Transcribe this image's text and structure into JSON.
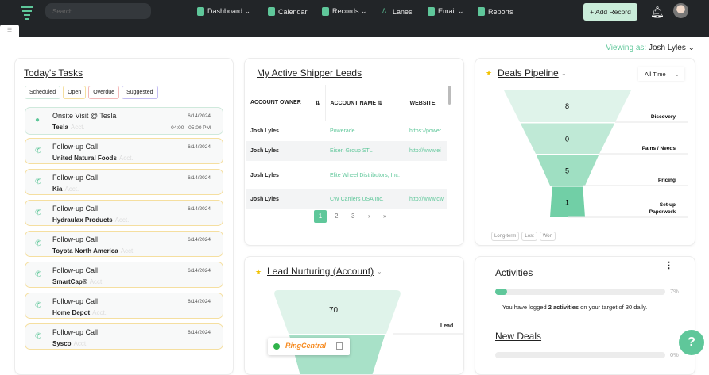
{
  "topbar": {
    "search_placeholder": "Search",
    "nav": [
      {
        "label": "Dashboard ⌄"
      },
      {
        "label": "Calendar"
      },
      {
        "label": "Records ⌄"
      },
      {
        "label": "Lanes"
      },
      {
        "label": "Email ⌄"
      },
      {
        "label": "Reports"
      }
    ],
    "add_record": "+ Add Record"
  },
  "viewing": {
    "label": "Viewing as:",
    "user": "Josh Lyles ⌄"
  },
  "tasks": {
    "title": "Today's Tasks",
    "filters": [
      "Scheduled",
      "Open",
      "Overdue",
      "Suggested"
    ],
    "items": [
      {
        "title": "Onsite Visit @ Tesla",
        "account": "Tesla",
        "date": "6/14/2024",
        "time": "04:00 - 05:00 PM",
        "icon": "location-pin-icon"
      },
      {
        "title": "Follow-up Call",
        "account": "United Natural Foods",
        "date": "6/14/2024",
        "icon": "phone-outgoing-icon"
      },
      {
        "title": "Follow-up Call",
        "account": "Kia",
        "date": "6/14/2024",
        "icon": "phone-outgoing-icon"
      },
      {
        "title": "Follow-up Call",
        "account": "Hydraulax Products",
        "date": "6/14/2024",
        "icon": "phone-outgoing-icon"
      },
      {
        "title": "Follow-up Call",
        "account": "Toyota North America",
        "date": "6/14/2024",
        "icon": "phone-outgoing-icon"
      },
      {
        "title": "Follow-up Call",
        "account": "SmartCap®",
        "date": "6/14/2024",
        "icon": "phone-outgoing-icon"
      },
      {
        "title": "Follow-up Call",
        "account": "Home Depot",
        "date": "6/14/2024",
        "icon": "phone-outgoing-icon"
      },
      {
        "title": "Follow-up Call",
        "account": "Sysco",
        "date": "6/14/2024",
        "icon": "phone-outgoing-icon"
      }
    ],
    "acct_tag": "Acct."
  },
  "leads": {
    "title": "My Active Shipper Leads",
    "columns": [
      "ACCOUNT OWNER",
      "ACCOUNT NAME",
      "WEBSITE"
    ],
    "rows": [
      [
        "Josh Lyles",
        "Powerade",
        "https://power"
      ],
      [
        "Josh Lyles",
        "Eisen Group STL",
        "http://www.ei"
      ],
      [
        "Josh Lyles",
        "Elite Wheel Distributors, Inc.",
        ""
      ],
      [
        "Josh Lyles",
        "CW Carriers USA Inc.",
        "http://www.cw"
      ]
    ],
    "pages": [
      "1",
      "2",
      "3",
      "›",
      "»"
    ]
  },
  "pipeline": {
    "title": "Deals Pipeline",
    "range": "All Time",
    "stages": [
      {
        "name": "Discovery",
        "value": 8
      },
      {
        "name": "Pains / Needs",
        "value": 0
      },
      {
        "name": "Pricing",
        "value": 5
      },
      {
        "name": "Set-up Paperwork",
        "value": 1
      }
    ],
    "tags": [
      "Long-term",
      "Lost",
      "Won"
    ]
  },
  "nurturing": {
    "title": "Lead Nurturing (Account)",
    "stages": [
      {
        "name": "Lead",
        "value": 70
      }
    ],
    "ringcentral": "RingCentral"
  },
  "activities": {
    "title": "Activities",
    "percent": 7,
    "percent_label": "7%",
    "text_pre": "You have logged ",
    "text_bold": "2 activities",
    "text_post": " on your target of 30 daily.",
    "new_deals_title": "New Deals",
    "new_deals_percent": 0,
    "new_deals_label": "0%"
  },
  "colors": {
    "accent": "#5fc79a",
    "topbar": "#222528"
  }
}
